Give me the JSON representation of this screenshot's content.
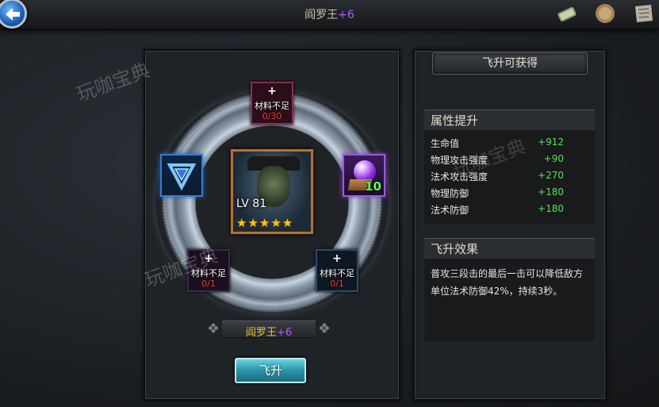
{
  "header": {
    "title": "阎罗王",
    "title_plus": "+6"
  },
  "materials": {
    "top": {
      "plus": "+",
      "status": "材料不足",
      "count": "0/30"
    },
    "bottom_left": {
      "plus": "+",
      "status": "材料不足",
      "count": "0/1"
    },
    "bottom_right": {
      "plus": "+",
      "status": "材料不足",
      "count": "0/1"
    },
    "right_item_count": "10"
  },
  "hero": {
    "level": "LV 81",
    "stars": "★★★★★",
    "star_count": 5
  },
  "name_plate": {
    "name": "阎罗王",
    "plus": "+6"
  },
  "ascend_button": "飞升",
  "rewards_panel": {
    "title": "飞升可获得",
    "attr_section_title": "属性提升",
    "attributes": [
      {
        "name": "生命值",
        "value": "+912"
      },
      {
        "name": "物理攻击强度",
        "value": "+90"
      },
      {
        "name": "法术攻击强度",
        "value": "+270"
      },
      {
        "name": "物理防御",
        "value": "+180"
      },
      {
        "name": "法术防御",
        "value": "+180"
      }
    ],
    "effect_section_title": "飞升效果",
    "effect_text": "普攻三段击的最后一击可以降低敌方单位法术防御42%，持续3秒。"
  },
  "watermark": "玩咖宝典",
  "icons": [
    "back-arrow-icon",
    "scroll-icon",
    "coin-icon",
    "map-icon",
    "shield-rune-icon",
    "magic-orb-icon"
  ],
  "colors": {
    "accent_green": "#58e05a",
    "warning_red": "#ff3535",
    "name_gold": "#f2c33c",
    "plus_purple": "#b35bff",
    "button_cyan": "#2a95a8"
  }
}
